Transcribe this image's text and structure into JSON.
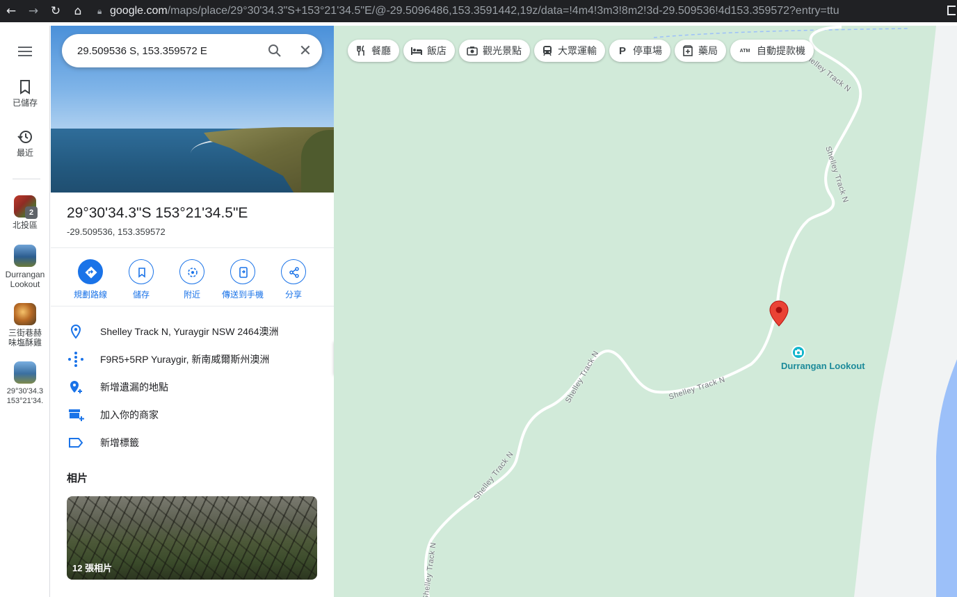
{
  "browser": {
    "url_host": "google.com",
    "url_path": "/maps/place/29°30'34.3\"S+153°21'34.5\"E/@-29.5096486,153.3591442,19z/data=!4m4!3m3!8m2!3d-29.509536!4d153.359572?entry=ttu"
  },
  "rail": {
    "saved_label": "已儲存",
    "recent_label": "最近",
    "history": [
      {
        "label": "北投區",
        "badge": "2"
      },
      {
        "label": "Durrangan Lookout"
      },
      {
        "label": "三街巷赫味塩酥雞"
      },
      {
        "label": "29°30'34.3 153°21'34."
      }
    ]
  },
  "search": {
    "query": "29.509536 S, 153.359572 E"
  },
  "place": {
    "title": "29°30'34.3\"S 153°21'34.5\"E",
    "coords": "-29.509536, 153.359572"
  },
  "actions": [
    {
      "label": "規劃路線",
      "icon": "directions-icon"
    },
    {
      "label": "儲存",
      "icon": "bookmark-icon"
    },
    {
      "label": "附近",
      "icon": "nearby-icon"
    },
    {
      "label": "傳送到手機",
      "icon": "send-to-phone-icon"
    },
    {
      "label": "分享",
      "icon": "share-icon"
    }
  ],
  "info": {
    "address": "Shelley Track N, Yuraygir NSW 2464澳洲",
    "plus_code": "F9R5+5RP Yuraygir, 新南威爾斯州澳洲",
    "add_missing": "新增遺漏的地點",
    "add_business": "加入你的商家",
    "add_label": "新增標籤"
  },
  "photos": {
    "title": "相片",
    "count_label": "12 張相片"
  },
  "chips": [
    {
      "label": "餐廳",
      "icon": "restaurant-icon"
    },
    {
      "label": "飯店",
      "icon": "hotel-icon"
    },
    {
      "label": "觀光景點",
      "icon": "camera-icon"
    },
    {
      "label": "大眾運輸",
      "icon": "transit-icon"
    },
    {
      "label": "停車場",
      "icon": "parking-icon"
    },
    {
      "label": "藥局",
      "icon": "pharmacy-icon"
    },
    {
      "label": "自動提款機",
      "icon": "atm-icon"
    }
  ],
  "map": {
    "road_name": "Shelley Track N",
    "poi_name": "Durrangan Lookout",
    "colors": {
      "land": "#d1ead9",
      "water": "#9cc0f9",
      "beach": "#f1f3f4",
      "pin": "#ea4335",
      "poi": "#12b5cb",
      "accent": "#1a73e8"
    }
  }
}
